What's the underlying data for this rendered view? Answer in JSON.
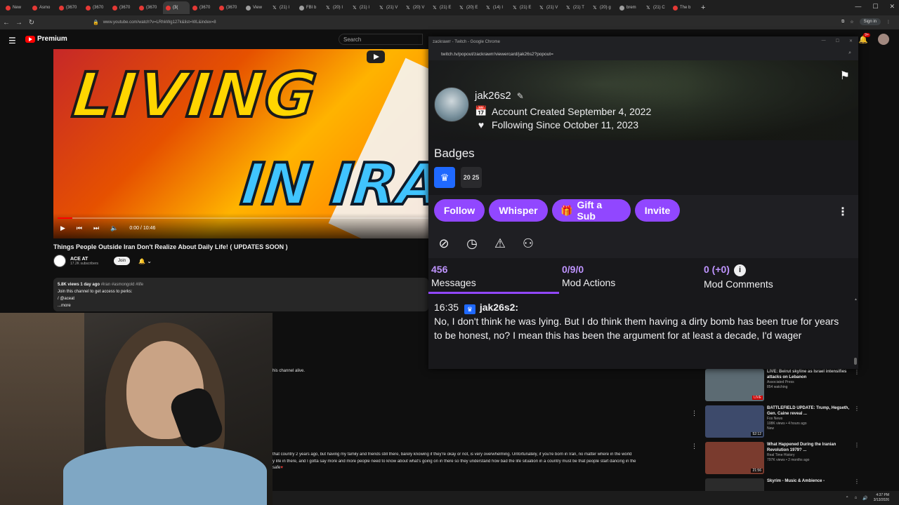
{
  "browser": {
    "tabs": [
      {
        "label": "New",
        "fav": "r"
      },
      {
        "label": "Asmo",
        "fav": "r"
      },
      {
        "label": "(3670",
        "fav": "r"
      },
      {
        "label": "(3670",
        "fav": "r"
      },
      {
        "label": "(3670",
        "fav": "r"
      },
      {
        "label": "(3670",
        "fav": "r"
      },
      {
        "label": "(3(",
        "fav": "r",
        "active": true
      },
      {
        "label": "(3670",
        "fav": "r"
      },
      {
        "label": "(3670",
        "fav": "r"
      },
      {
        "label": "View",
        "fav": "g"
      },
      {
        "label": "(21) I",
        "fav": "x"
      },
      {
        "label": "FBI b",
        "fav": "g"
      },
      {
        "label": "(20) I",
        "fav": "x"
      },
      {
        "label": "(21) I",
        "fav": "x"
      },
      {
        "label": "(21) V",
        "fav": "x"
      },
      {
        "label": "(20) V",
        "fav": "x"
      },
      {
        "label": "(21) E",
        "fav": "x"
      },
      {
        "label": "(20) E",
        "fav": "x"
      },
      {
        "label": "(14) I",
        "fav": "x"
      },
      {
        "label": "(21) E",
        "fav": "x"
      },
      {
        "label": "(21) V",
        "fav": "x"
      },
      {
        "label": "(21) T",
        "fav": "x"
      },
      {
        "label": "(20) g",
        "fav": "x"
      },
      {
        "label": "brem",
        "fav": "g"
      },
      {
        "label": "(21) C",
        "fav": "x"
      },
      {
        "label": "The b",
        "fav": "r"
      }
    ],
    "url": "www.youtube.com/watch?v=LRhkWg127k&list=WL&index=8",
    "sign_in": "Sign in"
  },
  "youtube": {
    "logo": "Premium",
    "search_placeholder": "Search",
    "notif_count": "9+",
    "thumbnail_text_1": "LIVING",
    "thumbnail_text_2": "IN IRA",
    "time": "0:00 / 10:46",
    "progress": 0.04,
    "title": "Things People Outside Iran Don't Realize About Daily Life! ( UPDATES SOON )",
    "channel": "ACE AT",
    "subscribers": "17.2K subscribers",
    "join": "Join",
    "description": {
      "stats": "5.8K views  1 day ago",
      "tags": "#iran #asmongold #life",
      "line2": "Join this channel to get access to perks:",
      "line3": "/ @aceat",
      "more": "...more"
    },
    "comment_snippet_1": "his channel alive.",
    "comment_snippet_2": "that country 2 years ago, but having my family and friends still there, barely knowing if they're okay or not, is very overwhelming. Unfortunately, if you're born in Iran, no matter where in the world",
    "comment_snippet_3": "y life in there, and I gotta say more and more people need to know about what's going on in there so they understand how bad the life situation in a country must be that people start dancing in the",
    "comment_snippet_4": "safe",
    "recommendations": [
      {
        "title": "LIVE: Beirut skyline as Israel intensifies attacks on Lebanon",
        "channel": "Associated Press",
        "views": "854 watching",
        "badge": "LIVE"
      },
      {
        "title": "BATTLEFIELD UPDATE: Trump, Hegseth, Gen. Caine reveal ...",
        "channel": "Fox News",
        "views": "108K views • 4 hours ago",
        "badge": "52:12",
        "extra": "New"
      },
      {
        "title": "What Happened During the Iranian Revolution 1979? ...",
        "channel": "Real Time History",
        "views": "797K views • 2 months ago",
        "badge": "21:56"
      },
      {
        "title": "Skyrim - Music & Ambience -",
        "channel": "",
        "views": "",
        "badge": ""
      }
    ]
  },
  "twitch": {
    "window_title": "zackrawrr - Twitch - Google Chrome",
    "url": "twitch.tv/popout/zackrawrr/viewercard/jak26s2?popout=",
    "username": "jak26s2",
    "account_created": "Account Created September 4, 2022",
    "following_since": "Following Since October 11, 2023",
    "badges_title": "Badges",
    "badge_year": "20 25",
    "buttons": {
      "follow": "Follow",
      "whisper": "Whisper",
      "gift": "Gift a Sub",
      "invite": "Invite"
    },
    "stats": {
      "messages_count": "456",
      "messages_label": "Messages",
      "mod_actions_count": "0/9/0",
      "mod_actions_label": "Mod Actions",
      "mod_comments_count": "0 (+0)",
      "mod_comments_label": "Mod Comments"
    },
    "message": {
      "time": "16:35",
      "user": "jak26s2:",
      "text": "No, I don't think he was lying. But I do think them having a dirty bomb has been true for years to be honest, no? I mean this has been the argument for at least a decade, I'd wager"
    }
  },
  "taskbar": {
    "time": "4:37 PM",
    "date": "3/13/2026"
  }
}
